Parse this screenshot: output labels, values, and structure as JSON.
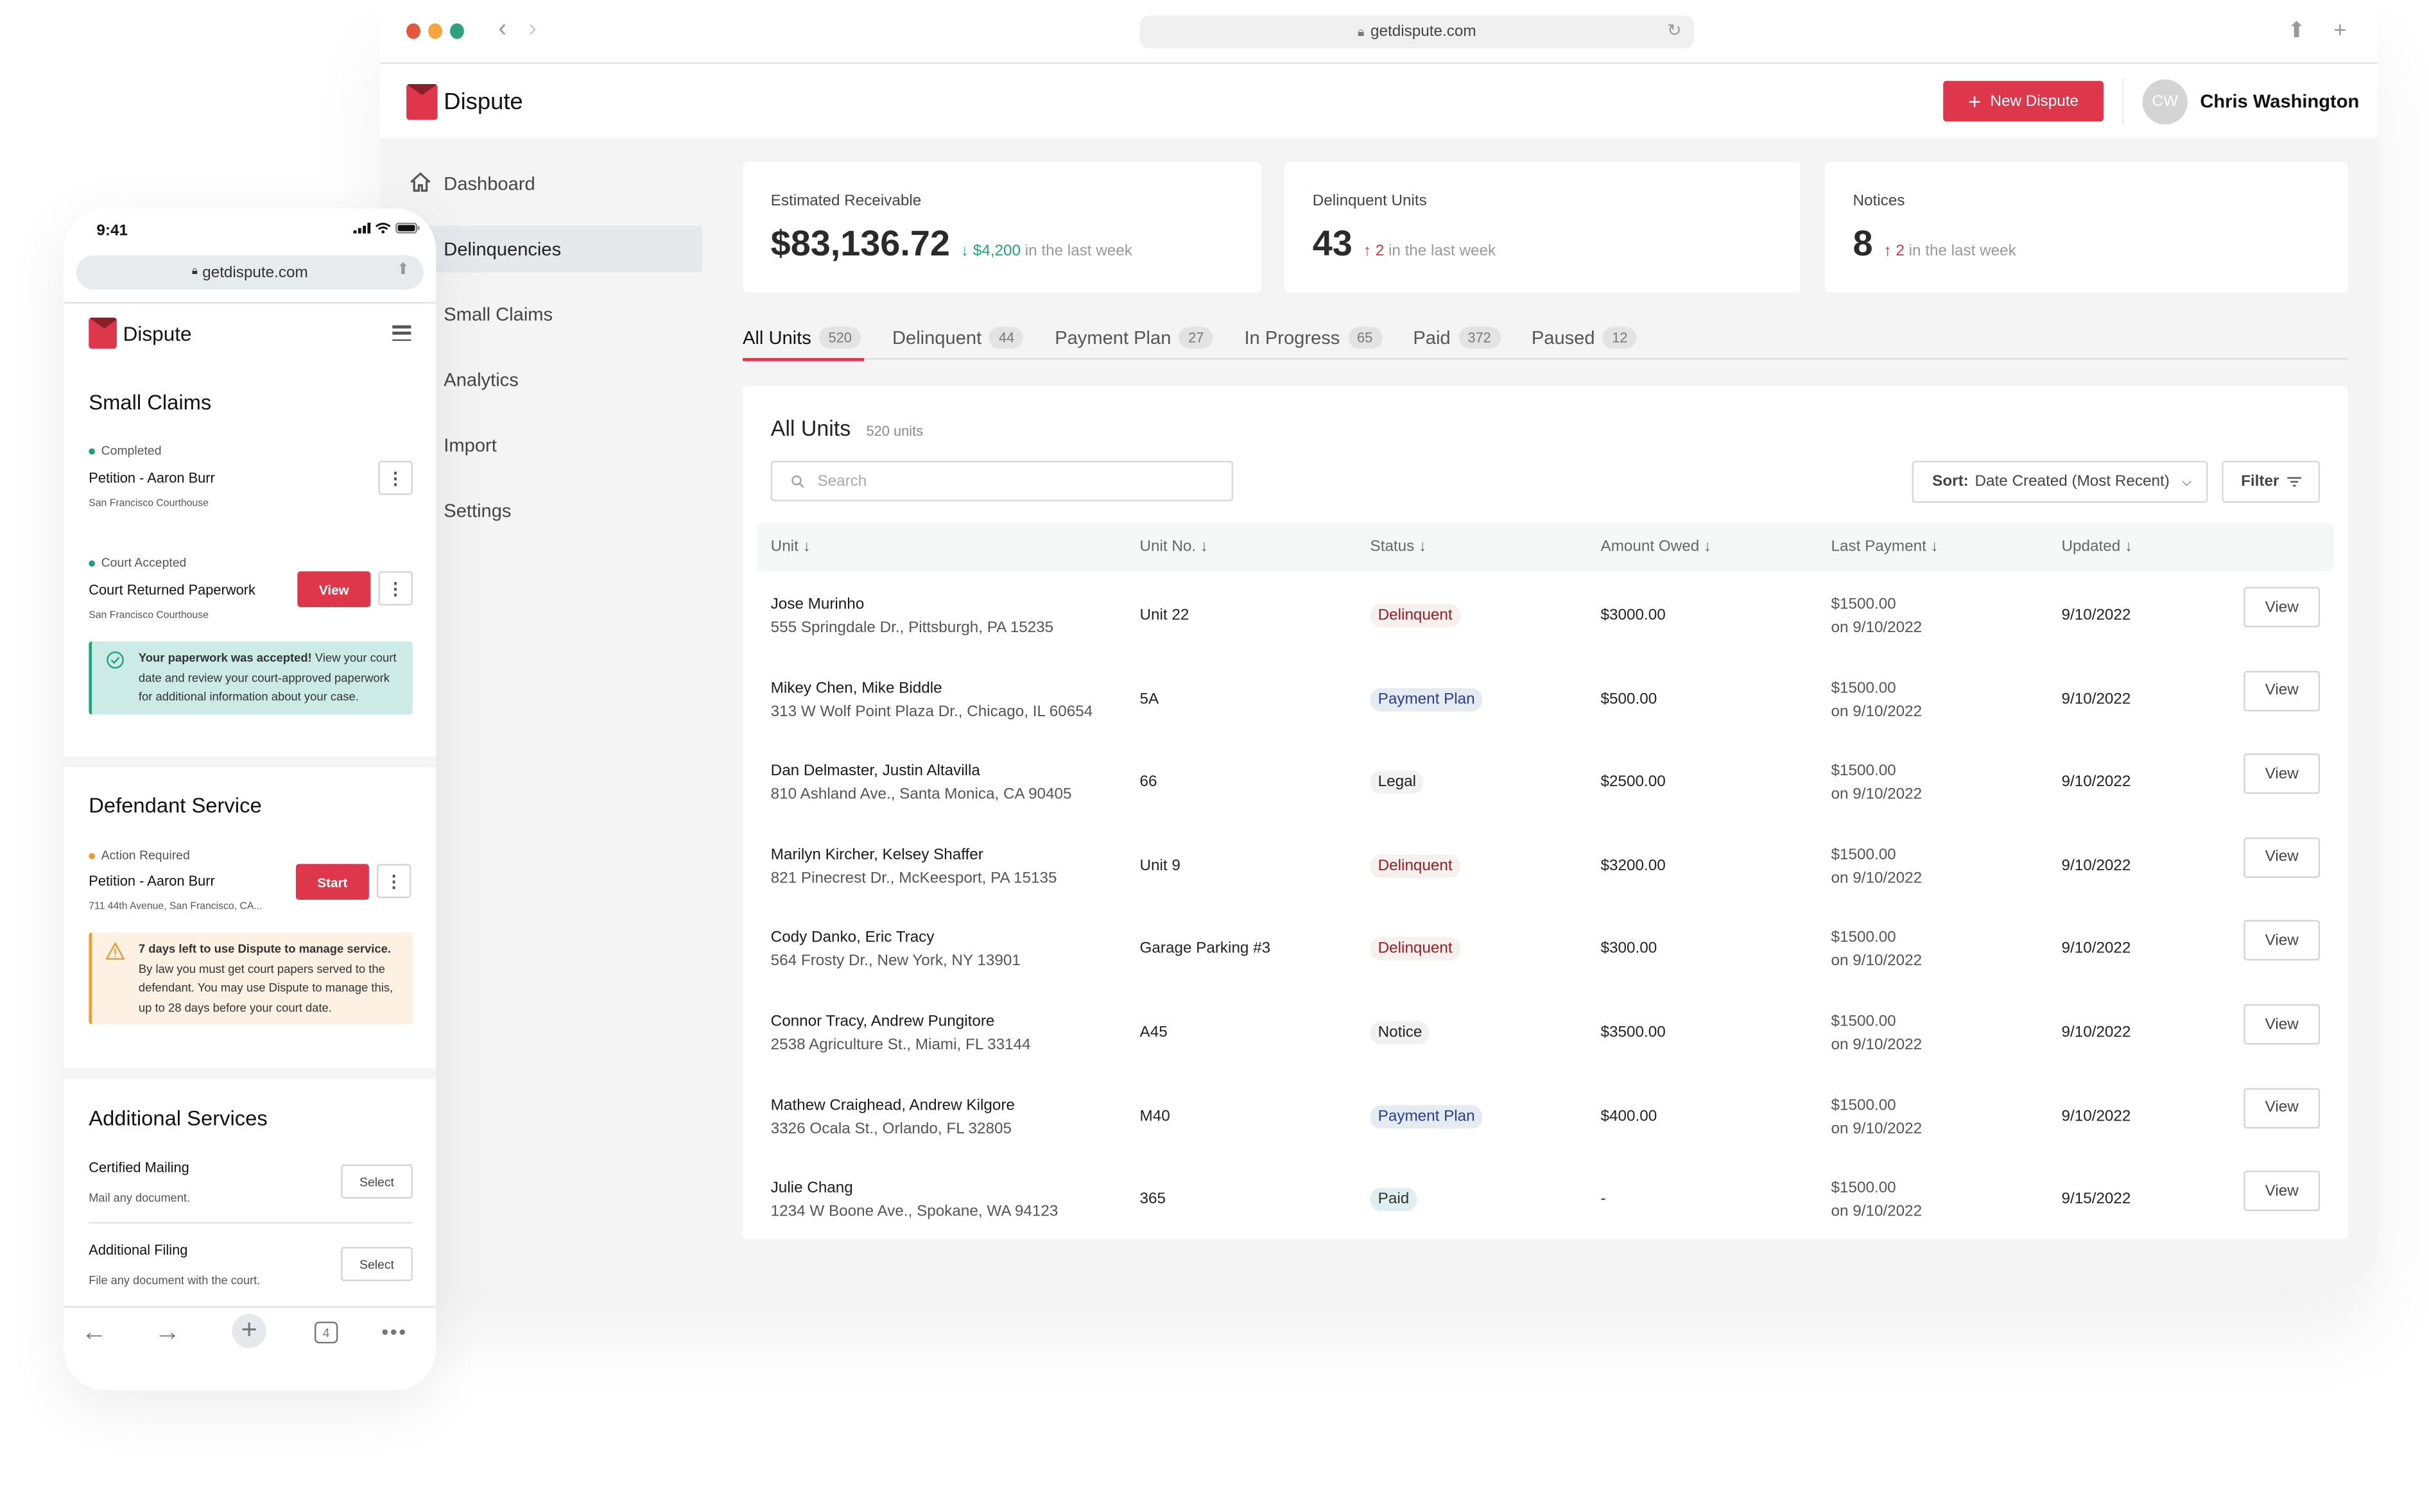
{
  "browser": {
    "url": "getdispute.com",
    "traffic_lights": {
      "close": "#e7563f",
      "minimize": "#f6a341",
      "maximize": "#2ea27c"
    }
  },
  "app": {
    "brand": "Dispute",
    "brand_color": "#de374b",
    "new_button_label": "New Dispute",
    "user": {
      "initials": "CW",
      "name": "Chris Washington"
    }
  },
  "sidebar": {
    "items": [
      {
        "label": "Dashboard",
        "icon": "home-icon",
        "active": false
      },
      {
        "label": "Delinquencies",
        "active": true
      },
      {
        "label": "Small Claims",
        "active": false
      },
      {
        "label": "Analytics",
        "active": false
      },
      {
        "label": "Import",
        "active": false
      },
      {
        "label": "Settings",
        "active": false
      }
    ]
  },
  "stats": [
    {
      "label": "Estimated Receivable",
      "value": "$83,136.72",
      "delta_arrow": "↓",
      "delta_value": "$4,200",
      "delta_text": "in the last week",
      "trend": "down"
    },
    {
      "label": "Delinquent Units",
      "value": "43",
      "delta_arrow": "↑",
      "delta_value": "2",
      "delta_text": "in the last week",
      "trend": "up"
    },
    {
      "label": "Notices",
      "value": "8",
      "delta_arrow": "↑",
      "delta_value": "2",
      "delta_text": "in the last week",
      "trend": "up"
    }
  ],
  "tabs": [
    {
      "label": "All Units",
      "count": "520",
      "active": true
    },
    {
      "label": "Delinquent",
      "count": "44"
    },
    {
      "label": "Payment Plan",
      "count": "27"
    },
    {
      "label": "In Progress",
      "count": "65"
    },
    {
      "label": "Paid",
      "count": "372"
    },
    {
      "label": "Paused",
      "count": "12"
    }
  ],
  "table": {
    "title": "All Units",
    "count_label": "520 units",
    "search_placeholder": "Search",
    "sort_prefix": "Sort:",
    "sort_value": "Date Created (Most Recent)",
    "filter_label": "Filter",
    "columns": [
      "Unit",
      "Unit No.",
      "Status",
      "Amount Owed",
      "Last Payment",
      "Updated"
    ],
    "view_label": "View",
    "rows": [
      {
        "name": "Jose Murinho",
        "address": "555 Springdale Dr., Pittsburgh, PA 15235",
        "unit_no": "Unit 22",
        "status": "Delinquent",
        "amount": "$3000.00",
        "last_payment": "$1500.00",
        "last_payment_date": "on 9/10/2022",
        "updated": "9/10/2022"
      },
      {
        "name": "Mikey Chen, Mike Biddle",
        "address": "313 W Wolf Point Plaza Dr., Chicago, IL 60654",
        "unit_no": "5A",
        "status": "Payment Plan",
        "amount": "$500.00",
        "last_payment": "$1500.00",
        "last_payment_date": "on 9/10/2022",
        "updated": "9/10/2022"
      },
      {
        "name": "Dan Delmaster, Justin Altavilla",
        "address": "810 Ashland Ave., Santa Monica, CA 90405",
        "unit_no": "66",
        "status": "Legal",
        "amount": "$2500.00",
        "last_payment": "$1500.00",
        "last_payment_date": "on 9/10/2022",
        "updated": "9/10/2022"
      },
      {
        "name": "Marilyn Kircher, Kelsey Shaffer",
        "address": "821 Pinecrest Dr., McKeesport, PA 15135",
        "unit_no": "Unit 9",
        "status": "Delinquent",
        "amount": "$3200.00",
        "last_payment": "$1500.00",
        "last_payment_date": "on 9/10/2022",
        "updated": "9/10/2022"
      },
      {
        "name": "Cody Danko, Eric Tracy",
        "address": "564 Frosty Dr., New York, NY 13901",
        "unit_no": "Garage Parking #3",
        "status": "Delinquent",
        "amount": "$300.00",
        "last_payment": "$1500.00",
        "last_payment_date": "on 9/10/2022",
        "updated": "9/10/2022"
      },
      {
        "name": "Connor Tracy, Andrew Pungitore",
        "address": "2538 Agriculture St., Miami, FL 33144",
        "unit_no": "A45",
        "status": "Notice",
        "amount": "$3500.00",
        "last_payment": "$1500.00",
        "last_payment_date": "on 9/10/2022",
        "updated": "9/10/2022"
      },
      {
        "name": "Mathew Craighead, Andrew Kilgore",
        "address": "3326 Ocala St., Orlando, FL 32805",
        "unit_no": "M40",
        "status": "Payment Plan",
        "amount": "$400.00",
        "last_payment": "$1500.00",
        "last_payment_date": "on 9/10/2022",
        "updated": "9/10/2022"
      },
      {
        "name": "Julie Chang",
        "address": "1234 W Boone Ave., Spokane, WA 94123",
        "unit_no": "365",
        "status": "Paid",
        "amount": "-",
        "last_payment": "$1500.00",
        "last_payment_date": "on 9/10/2022",
        "updated": "9/15/2022"
      }
    ]
  },
  "phone": {
    "time": "9:41",
    "url": "getdispute.com",
    "brand": "Dispute",
    "small_claims": {
      "title": "Small Claims",
      "items": [
        {
          "status": "Completed",
          "status_color": "#1fa17a",
          "title": "Petition - Aaron Burr",
          "subtitle": "San Francisco Courthouse"
        },
        {
          "status": "Court Accepted",
          "status_color": "#1fa17a",
          "title": "Court Returned Paperwork",
          "subtitle": "San Francisco Courthouse",
          "button": "View"
        }
      ],
      "alert_bold": "Your paperwork was accepted!",
      "alert_text": " View your court date and review your court-approved paperwork for additional information about your case."
    },
    "defendant_service": {
      "title": "Defendant Service",
      "item": {
        "status": "Action Required",
        "status_color": "#f39a34",
        "title": "Petition - Aaron Burr",
        "subtitle": "711 44th Avenue, San Francisco, CA...",
        "button": "Start"
      },
      "alert_bold": "7 days left to use Dispute to manage service.",
      "alert_text": " By law you must get court papers served to the defendant. You may use Dispute to manage this, up to 28 days before your court date."
    },
    "additional_services": {
      "title": "Additional Services",
      "items": [
        {
          "title": "Certified Mailing",
          "subtitle": "Mail any document.",
          "button": "Select"
        },
        {
          "title": "Additional Filing",
          "subtitle": "File any document with the court.",
          "button": "Select"
        }
      ]
    },
    "toolbar": {
      "tab_count": "4"
    }
  }
}
